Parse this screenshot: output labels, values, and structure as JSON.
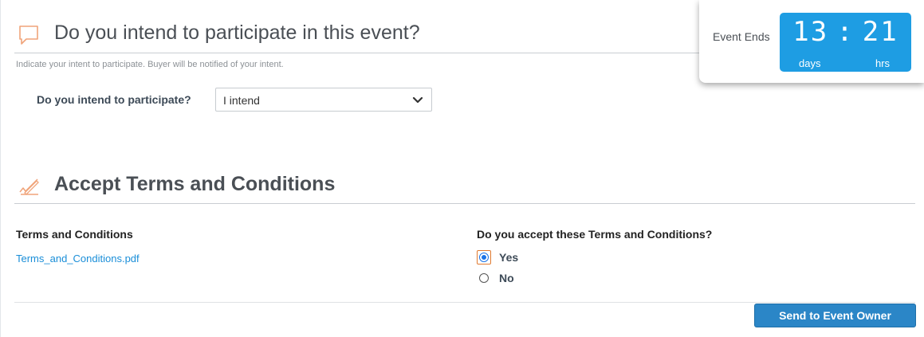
{
  "intent_section": {
    "title": "Do you intend to participate in this event?",
    "description": "Indicate your intent to participate. Buyer will be notified of your intent.",
    "question_label": "Do you intend to participate?",
    "selected_value": "I intend",
    "icon": "speech-bubble-icon"
  },
  "countdown": {
    "label": "Event Ends",
    "days": "13",
    "hours": "21",
    "days_unit": "days",
    "hours_unit": "hrs",
    "accent": "#1e9de3"
  },
  "terms_section": {
    "title": "Accept Terms and Conditions",
    "icon": "pencil-check-icon",
    "documents_heading": "Terms and Conditions",
    "document_link": "Terms_and_Conditions.pdf",
    "question": "Do you accept these Terms and Conditions?",
    "options": [
      {
        "label": "Yes",
        "selected": true
      },
      {
        "label": "No",
        "selected": false
      }
    ]
  },
  "actions": {
    "send_label": "Send to Event Owner"
  },
  "colors": {
    "icon_accent": "#f0a47a",
    "link": "#1a8ed8",
    "primary_button": "#2b86c7"
  }
}
